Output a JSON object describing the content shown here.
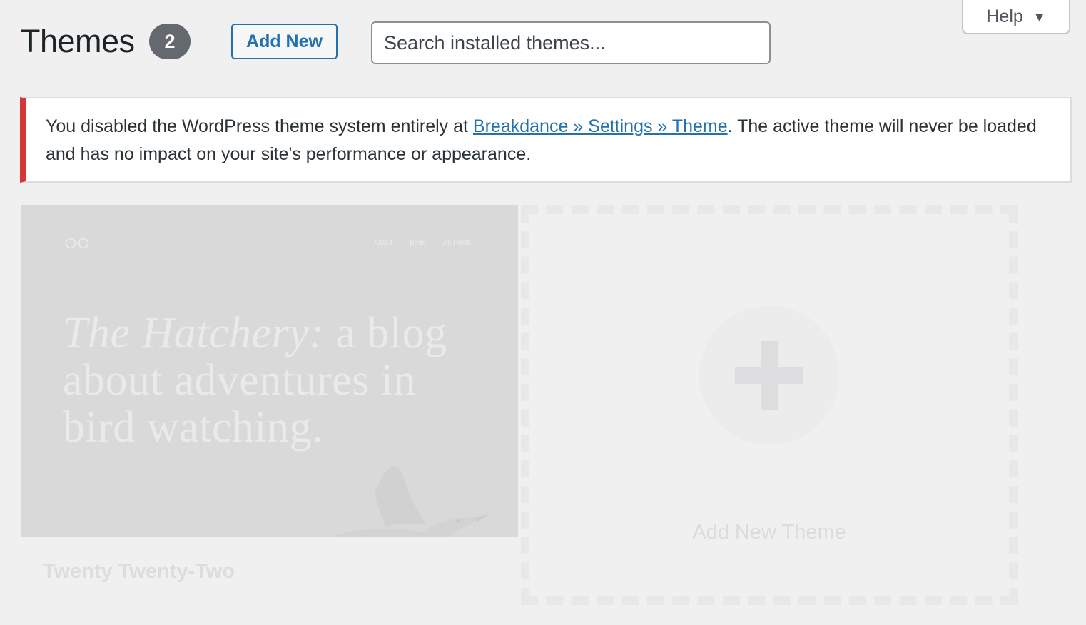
{
  "help": {
    "label": "Help",
    "caret": "▼"
  },
  "header": {
    "title": "Themes",
    "count": "2",
    "add_new_label": "Add New",
    "search_placeholder": "Search installed themes..."
  },
  "notice": {
    "text_before": "You disabled the WordPress theme system entirely at ",
    "link_text": "Breakdance » Settings » Theme",
    "text_after": ". The active theme will never be loaded and has no impact on your site's performance or appearance.",
    "accent_color": "#d63638"
  },
  "theme": {
    "name": "Twenty Twenty-Two",
    "screenshot": {
      "nav": [
        "About",
        "Birds",
        "All Posts"
      ],
      "headline_italic": "The Hatchery:",
      "headline_rest": " a blog about adventures in bird watching."
    }
  },
  "add_new_theme": {
    "label": "Add New Theme"
  },
  "colors": {
    "background": "#f0f0f1",
    "link": "#2271b1",
    "badge": "#646970"
  }
}
